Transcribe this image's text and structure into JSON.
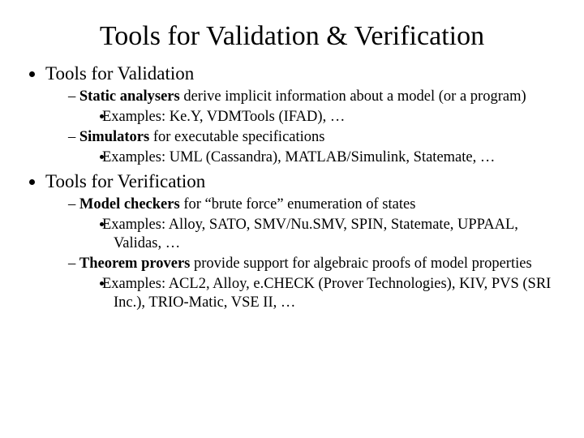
{
  "title": "Tools for Validation & Verification",
  "sections": [
    {
      "heading": "Tools for Validation",
      "items": [
        {
          "bold": "Static analysers",
          "rest": " derive implicit information about a model (or a program)",
          "examples": "Examples: Ke.Y, VDMTools (IFAD), …"
        },
        {
          "bold": "Simulators",
          "rest": " for executable specifications",
          "examples": "Examples: UML (Cassandra), MATLAB/Simulink, Statemate, …"
        }
      ]
    },
    {
      "heading": "Tools for Verification",
      "items": [
        {
          "bold": "Model checkers",
          "rest": " for “brute force” enumeration of states",
          "examples": "Examples: Alloy, SATO, SMV/Nu.SMV, SPIN, Statemate, UPPAAL, Validas, …"
        },
        {
          "bold": "Theorem provers",
          "rest": " provide support for algebraic proofs of model properties",
          "examples": "Examples: ACL2, Alloy, e.CHECK (Prover Technologies), KIV, PVS (SRI Inc.), TRIO-Matic, VSE II, …"
        }
      ]
    }
  ]
}
